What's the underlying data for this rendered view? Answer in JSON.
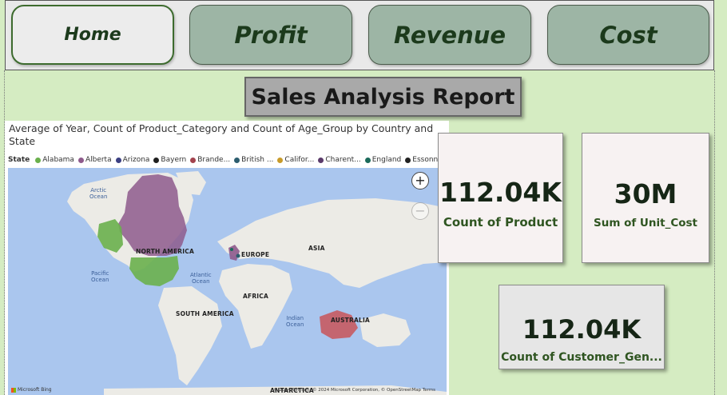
{
  "nav": {
    "home": "Home",
    "profit": "Profit",
    "revenue": "Revenue",
    "cost": "Cost"
  },
  "report_title": "Sales Analysis Report",
  "map": {
    "title": "Average of Year, Count of Product_Category and Count of Age_Group by Country and State",
    "legend_title": "State",
    "legend": [
      {
        "label": "Alabama",
        "color": "#6ab04c"
      },
      {
        "label": "Alberta",
        "color": "#8e5a8c"
      },
      {
        "label": "Arizona",
        "color": "#3b3f82"
      },
      {
        "label": "Bayern",
        "color": "#1f1f1f"
      },
      {
        "label": "Brande...",
        "color": "#a3434e"
      },
      {
        "label": "British ...",
        "color": "#2c5d6e"
      },
      {
        "label": "Califor...",
        "color": "#c89b2a"
      },
      {
        "label": "Charent...",
        "color": "#5a3a6a"
      },
      {
        "label": "England",
        "color": "#1b6a5a"
      },
      {
        "label": "Essonne",
        "color": "#222222"
      }
    ],
    "legend_more": "▸",
    "zoom_in": "+",
    "zoom_out": "−",
    "regions": {
      "north_america": "NORTH AMERICA",
      "europe": "EUROPE",
      "asia": "ASIA",
      "africa": "AFRICA",
      "south_america": "SOUTH AMERICA",
      "australia": "AUSTRALIA",
      "antarctica": "ANTARCTICA"
    },
    "oceans": {
      "arctic": "Arctic\nOcean",
      "pacific": "Pacific\nOcean",
      "atlantic": "Atlantic\nOcean",
      "indian": "Indian\nOcean"
    },
    "provider": "Microsoft Bing",
    "copyright": "© 2024 TomTom, © 2024 Microsoft Corporation, © OpenStreetMap  Terms"
  },
  "cards": {
    "count_product": {
      "value": "112.04K",
      "label": "Count of Product"
    },
    "sum_unit_cost": {
      "value": "30M",
      "label": "Sum of Unit_Cost"
    },
    "count_customer_gender": {
      "value": "112.04K",
      "label": "Count of Customer_Gen..."
    }
  },
  "colors": {
    "background": "#d5ecc2",
    "nav_tab": "#9db5a5",
    "home_tab": "#ececec",
    "title_box": "#a9a9a9",
    "card_light": "#f7f2f2",
    "card_gray": "#e6e6e6"
  }
}
